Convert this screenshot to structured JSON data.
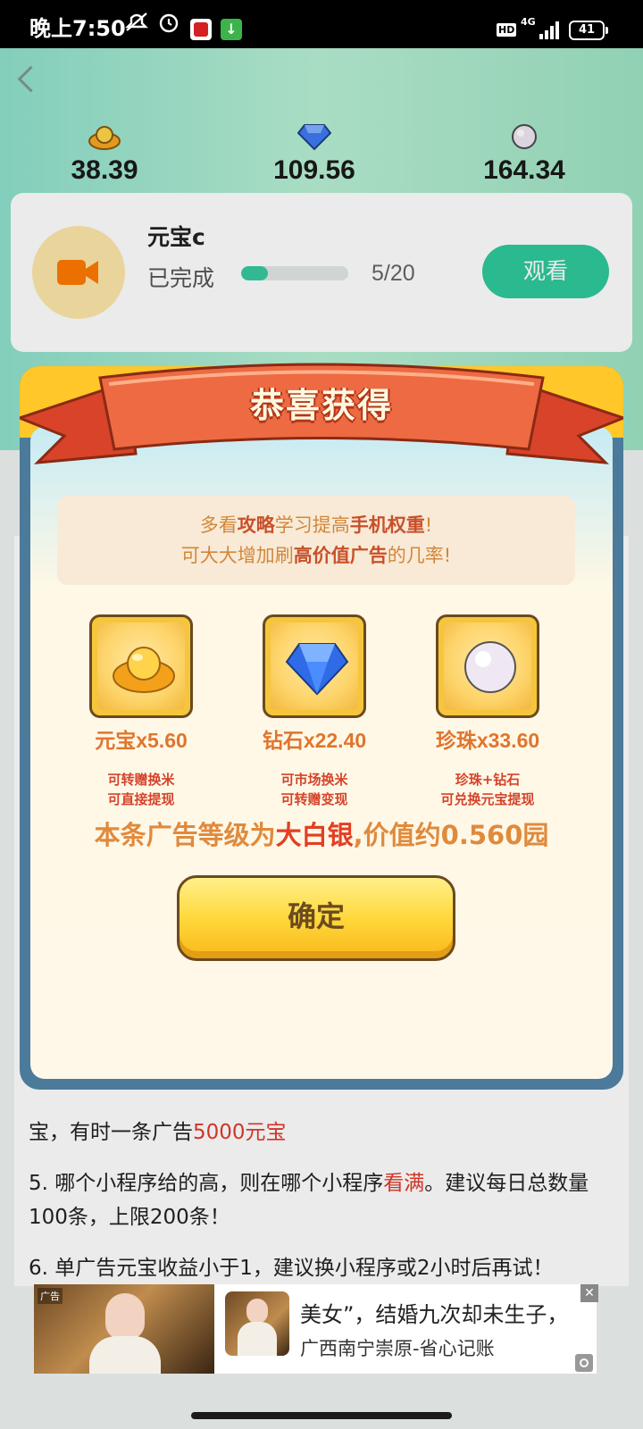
{
  "status_bar": {
    "time": "晚上7:50",
    "network": "4G",
    "hd": "HD",
    "battery": "41"
  },
  "currencies": [
    {
      "name": "元宝",
      "icon": "gold-ingot-icon",
      "value": "38.39"
    },
    {
      "name": "钻石",
      "icon": "diamond-icon",
      "value": "109.56"
    },
    {
      "name": "珍珠",
      "icon": "pearl-icon",
      "value": "164.34"
    }
  ],
  "task": {
    "name": "元宝c",
    "status": "已完成",
    "progress_fraction": 0.25,
    "count": "5/20",
    "watch_label": "观看"
  },
  "page_tips": {
    "tip4_line2_prefix": "宝，有时一条广告",
    "tip4_line2_highlight": "5000元宝",
    "tip5_prefix": "5. 哪个小程序给的高，则在哪个小程序",
    "tip5_highlight": "看满",
    "tip5_suffix": "。建议每日总数量100条，上限200条！",
    "tip6": "6. 单广告元宝收益小于1，建议换小程序或2小时后再试！"
  },
  "dialog": {
    "title": "恭喜获得",
    "hint_line1": {
      "p1": "多看",
      "b1": "攻略",
      "p2": "学习提高",
      "b2": "手机权重",
      "p3": "!"
    },
    "hint_line2": {
      "p1": "可大大增加刷",
      "b1": "高价值广告",
      "p2": "的几率!"
    },
    "rewards": [
      {
        "label": "元宝",
        "amount": "x5.60",
        "desc1": "可转赠换米",
        "desc2": "可直接提现"
      },
      {
        "label": "钻石",
        "amount": "x22.40",
        "desc1": "可市场换米",
        "desc2": "可转赠变现"
      },
      {
        "label": "珍珠",
        "amount": "x33.60",
        "desc1": "珍珠+钻石",
        "desc2": "可兑换元宝提现"
      }
    ],
    "value_prefix": "本条广告等级为",
    "value_level": "大白银",
    "value_suffix": ",价值约0.560园",
    "confirm_label": "确定"
  },
  "ad": {
    "tag": "广告",
    "title": "美女”，结婚九次却未生子，",
    "subtitle": "广西南宁崇原-省心记账",
    "close": "✕"
  },
  "colors": {
    "accent_green": "#2fc99c",
    "dialog_border": "#4b7a9a",
    "ribbon": "#e8553a",
    "highlight_red": "#e23a2b"
  }
}
